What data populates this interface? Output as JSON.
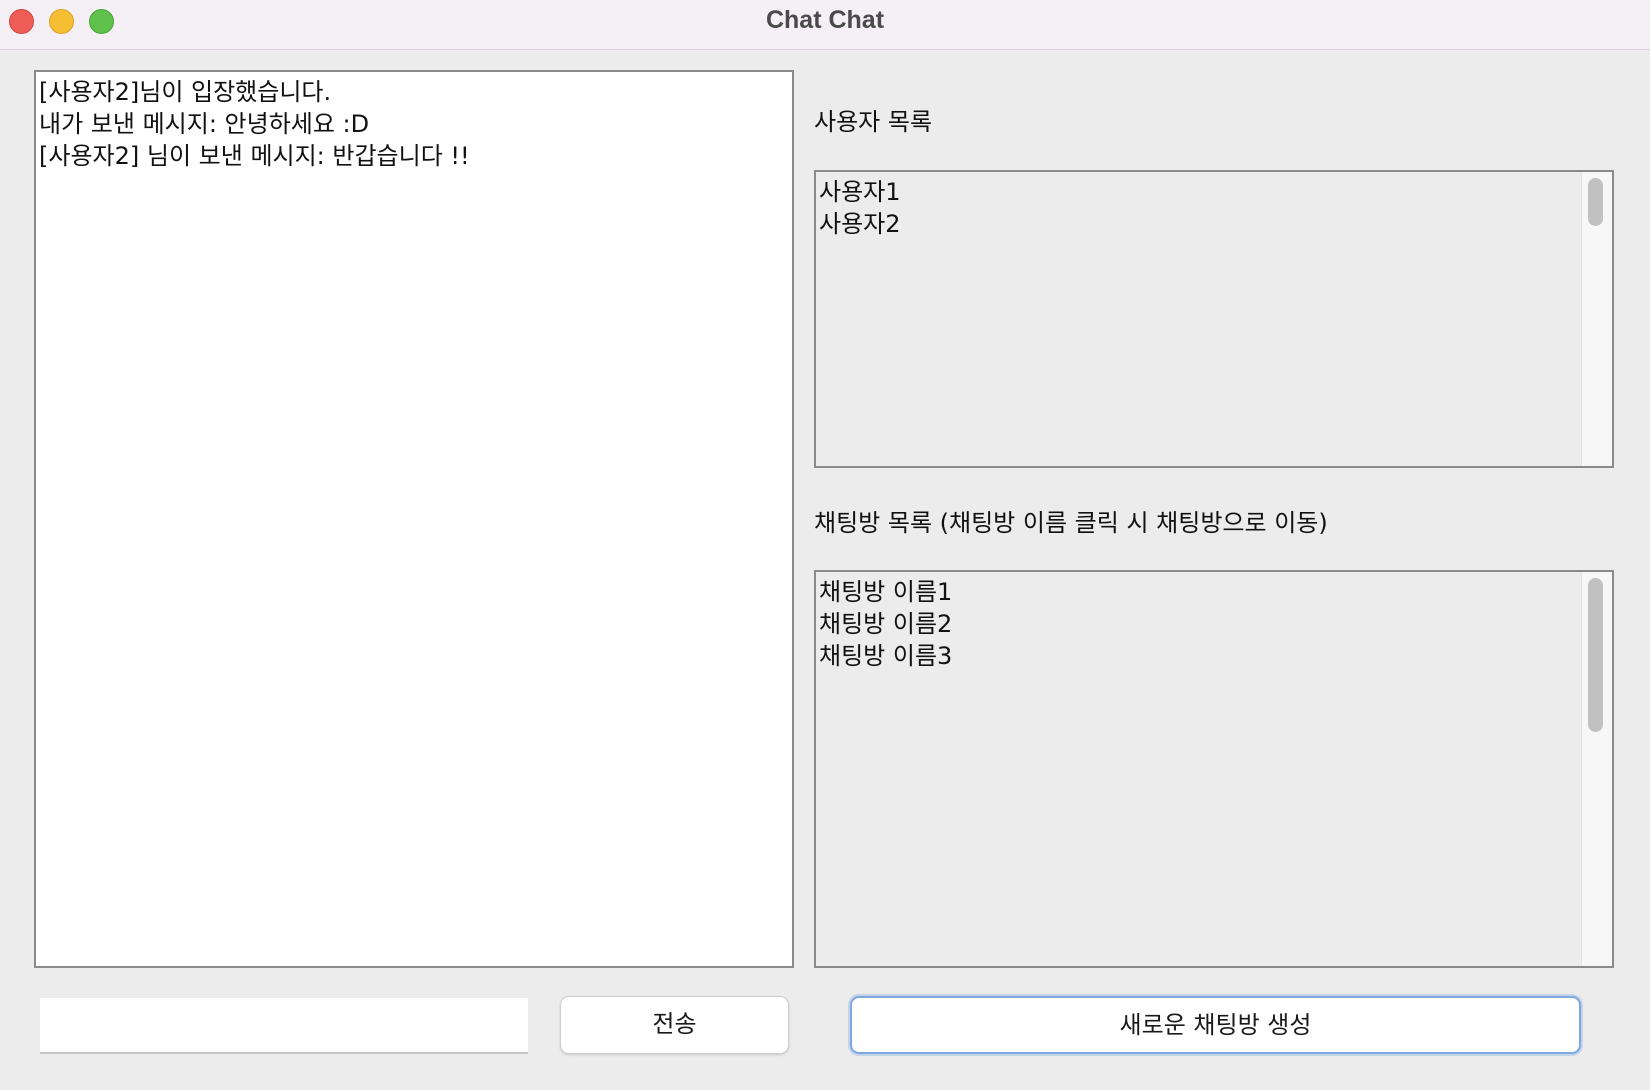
{
  "window": {
    "title": "Chat Chat"
  },
  "chat": {
    "messages": [
      "[사용자2]님이 입장했습니다.",
      "내가 보낸 메시지: 안녕하세요 :D",
      "[사용자2] 님이 보낸 메시지: 반갑습니다 !!"
    ]
  },
  "users": {
    "label": "사용자 목록",
    "items": [
      "사용자1",
      "사용자2"
    ]
  },
  "rooms": {
    "label": "채팅방 목록 (채팅방 이름 클릭 시 채팅방으로 이동)",
    "items": [
      "채팅방 이름1",
      "채팅방 이름2",
      "채팅방 이름3"
    ]
  },
  "composer": {
    "input_value": "",
    "send_label": "전송",
    "create_room_label": "새로운 채팅방 생성"
  },
  "colors": {
    "close": "#ee5d58",
    "minimize": "#f6be33",
    "maximize": "#5fc04b",
    "focus_ring": "#7fa8e2"
  }
}
